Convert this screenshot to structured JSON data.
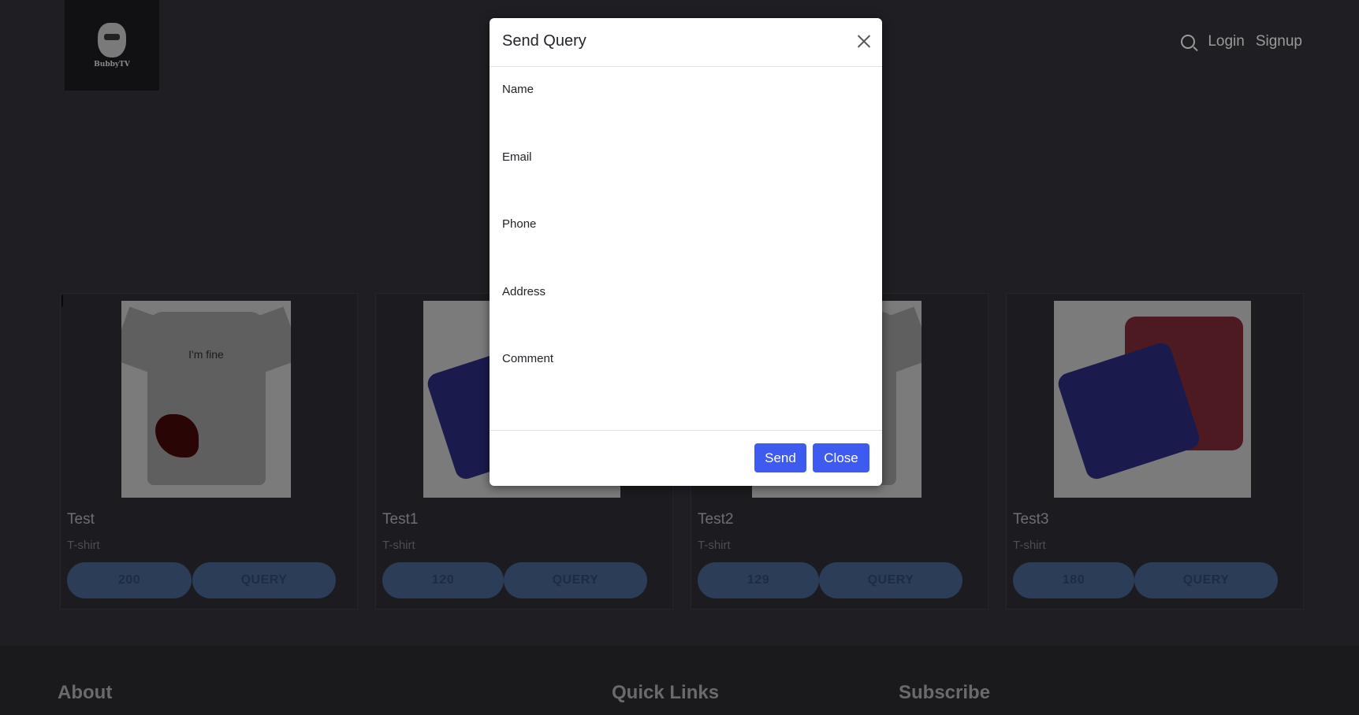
{
  "header": {
    "logo_text": "BubbyTV",
    "login_label": "Login",
    "signup_label": "Signup"
  },
  "products": [
    {
      "title": "Test",
      "category": "T-shirt",
      "price": "200",
      "query_label": "QUERY",
      "image_text": "I'm fine"
    },
    {
      "title": "Test1",
      "category": "T-shirt",
      "price": "120",
      "query_label": "QUERY"
    },
    {
      "title": "Test2",
      "category": "T-shirt",
      "price": "129",
      "query_label": "QUERY"
    },
    {
      "title": "Test3",
      "category": "T-shirt",
      "price": "180",
      "query_label": "QUERY"
    }
  ],
  "footer": {
    "about": "About",
    "quick_links": "Quick Links",
    "subscribe": "Subscribe"
  },
  "modal": {
    "title": "Send Query",
    "fields": {
      "name": "Name",
      "email": "Email",
      "phone": "Phone",
      "address": "Address",
      "comment": "Comment"
    },
    "send_label": "Send",
    "close_label": "Close"
  },
  "colors": {
    "accent": "#3d5af1",
    "backdrop": "#1f1f23",
    "modal_bg": "#ffffff"
  }
}
